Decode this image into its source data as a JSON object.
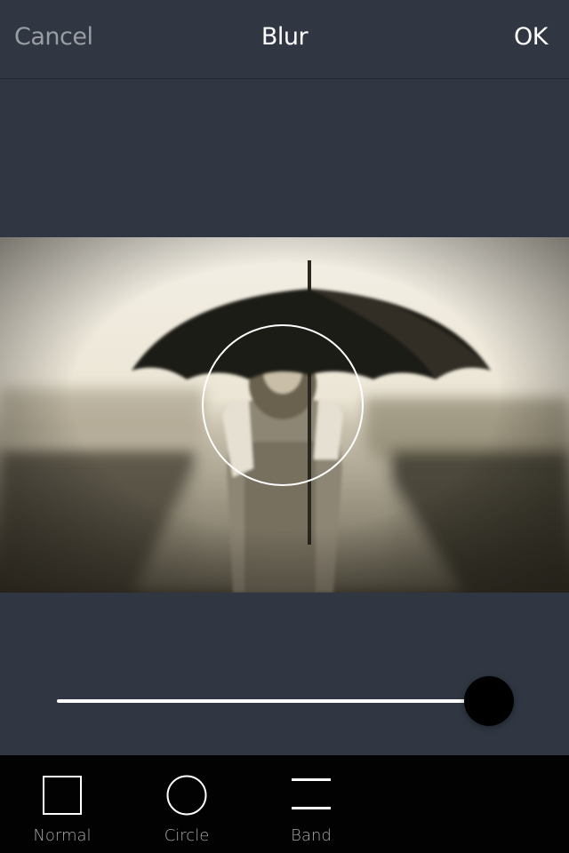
{
  "header": {
    "cancel_label": "Cancel",
    "title": "Blur",
    "ok_label": "OK"
  },
  "photo": {
    "description": "Sepia photo of a woman under a black umbrella on a road",
    "focus_shape": "circle"
  },
  "slider": {
    "value_fraction": 0.95
  },
  "toolbar": {
    "items": [
      {
        "label": "Normal",
        "icon": "square-icon"
      },
      {
        "label": "Circle",
        "icon": "circle-icon"
      },
      {
        "label": "Band",
        "icon": "band-icon"
      }
    ]
  },
  "colors": {
    "background": "#303742",
    "toolbar": "#020202",
    "cancel_text": "#9a9ea4",
    "primary_text": "#ffffff",
    "tool_label": "#a9a9a9"
  }
}
